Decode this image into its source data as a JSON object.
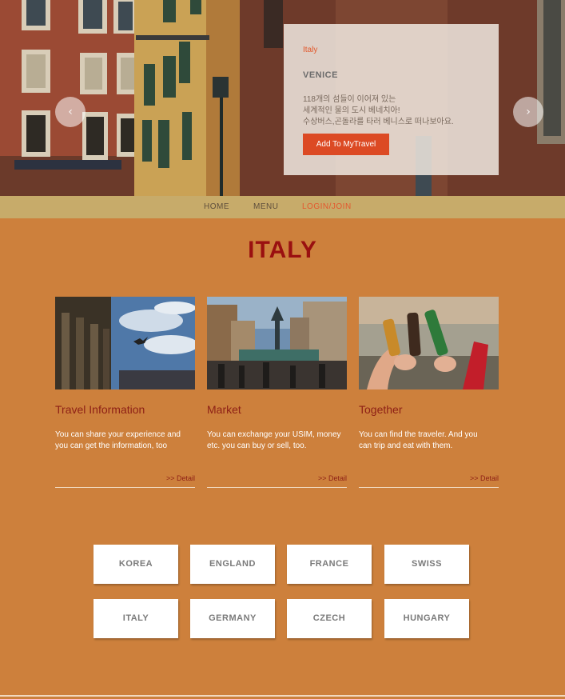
{
  "hero": {
    "country": "Italy",
    "city": "VENICE",
    "description": [
      "118개의 섬들이 이어져 있는",
      "세계적인 물의 도시 베네치아!",
      "수상버스,곤돌라를 타러 베니스로 떠나보아요."
    ],
    "button_label": "Add To MyTravel",
    "prev_icon": "chevron-left-icon",
    "next_icon": "chevron-right-icon",
    "prev_glyph": "‹",
    "next_glyph": "›"
  },
  "nav": {
    "items": [
      {
        "label": "HOME"
      },
      {
        "label": "MENU"
      },
      {
        "label": "LOGIN/JOIN"
      }
    ],
    "active_color": "#e4572e"
  },
  "main": {
    "title": "ITALY",
    "cards": [
      {
        "title": "Travel Information",
        "text": [
          "You can share your experience and",
          "you can get the information, too"
        ],
        "detail": ">> Detail"
      },
      {
        "title": "Market",
        "text": [
          "You can exchange your USIM, money",
          "etc. you can buy or sell, too."
        ],
        "detail": ">> Detail"
      },
      {
        "title": "Together",
        "text": [
          "You can find the traveler. And you",
          "can trip and eat with them."
        ],
        "detail": ">> Detail"
      }
    ]
  },
  "countries": [
    "KOREA",
    "ENGLAND",
    "FRANCE",
    "SWISS",
    "ITALY",
    "GERMANY",
    "CZECH",
    "HUNGARY"
  ],
  "colors": {
    "background": "#cd803c",
    "nav": "#c7ab6a",
    "title": "#9a1010",
    "button": "#dc4a24"
  }
}
